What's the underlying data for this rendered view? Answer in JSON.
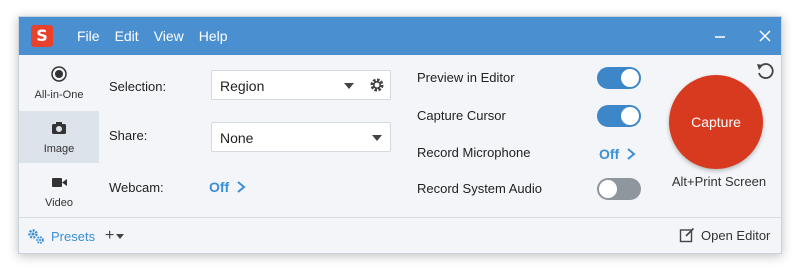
{
  "titlebar": {
    "logo_letter": "S",
    "menu": [
      "File",
      "Edit",
      "View",
      "Help"
    ]
  },
  "sidebar": {
    "modes": [
      {
        "label": "All-in-One",
        "icon": "record-icon",
        "selected": false
      },
      {
        "label": "Image",
        "icon": "camera-icon",
        "selected": true
      },
      {
        "label": "Video",
        "icon": "video-camera-icon",
        "selected": false
      }
    ]
  },
  "settings": {
    "selection_label": "Selection:",
    "selection_value": "Region",
    "share_label": "Share:",
    "share_value": "None",
    "webcam_label": "Webcam:",
    "webcam_value": "Off"
  },
  "options": {
    "preview_label": "Preview in Editor",
    "preview_on": true,
    "cursor_label": "Capture Cursor",
    "cursor_on": true,
    "mic_label": "Record Microphone",
    "mic_value": "Off",
    "audio_label": "Record System Audio",
    "audio_on": false
  },
  "capture": {
    "button_label": "Capture",
    "shortcut": "Alt+Print Screen"
  },
  "footer": {
    "presets_label": "Presets",
    "add_label": "+",
    "open_editor_label": "Open Editor"
  },
  "colors": {
    "titlebar": "#4a8fd0",
    "accent_blue": "#3a8fd6",
    "capture_red": "#d73a1f",
    "logo_red": "#e8412c"
  }
}
